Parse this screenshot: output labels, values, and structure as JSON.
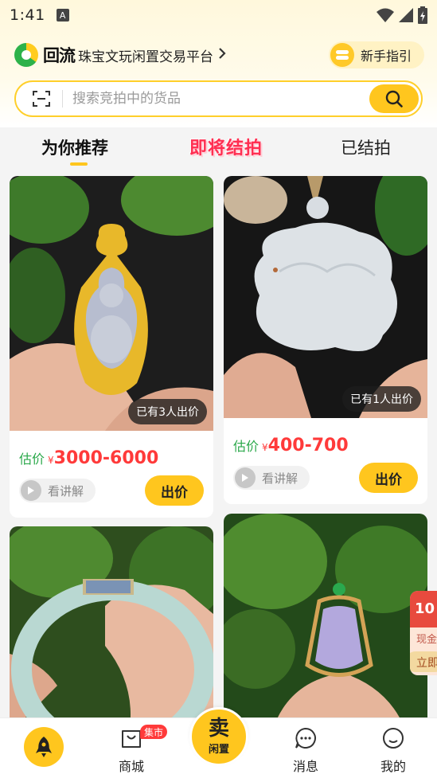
{
  "status_bar": {
    "time": "1:41",
    "a_icon": "A"
  },
  "header": {
    "brand_mark": "回流",
    "slogan": "珠宝文玩闲置交易平台",
    "guide_label": "新手指引"
  },
  "search": {
    "placeholder": "搜索竞拍中的货品"
  },
  "tabs": [
    {
      "label": "为你推荐",
      "active": true
    },
    {
      "label": "即将结拍",
      "active": false
    },
    {
      "label": "已结拍",
      "active": false
    }
  ],
  "products": [
    {
      "bid_badge": "已有3人出价",
      "price_label": "估价",
      "currency": "¥",
      "price": "3000-6000",
      "explain_label": "看讲解",
      "offer_label": "出价"
    },
    {
      "bid_badge": "已有1人出价",
      "price_label": "估价",
      "currency": "¥",
      "price": "400-700",
      "explain_label": "看讲解",
      "offer_label": "出价"
    }
  ],
  "coupon": {
    "top": "10",
    "middle": "现金",
    "button": "立即"
  },
  "bottom_nav": {
    "market_badge": "集市",
    "items": [
      {
        "label": "商城"
      },
      {
        "label_big": "卖",
        "label_small": "闲置"
      },
      {
        "label": "消息"
      },
      {
        "label": "我的"
      }
    ]
  },
  "colors": {
    "accent_yellow": "#ffc61e",
    "price_red": "#ff3a3a",
    "price_label_green": "#2aa84a",
    "tab_highlight_red": "#ff2f52"
  }
}
